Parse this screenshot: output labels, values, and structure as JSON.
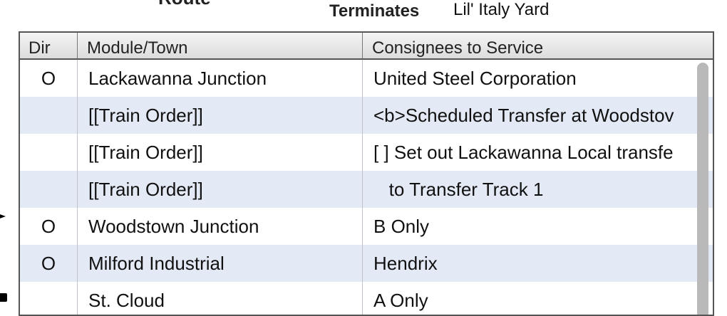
{
  "route_label": "Route",
  "terminates": {
    "label": "Terminates",
    "value": "Lil' Italy Yard"
  },
  "table": {
    "columns": [
      "Dir",
      "Module/Town",
      "Consignees to Service"
    ],
    "rows": [
      {
        "dir": "O",
        "module": "Lackawanna Junction",
        "consignee": "United Steel Corporation"
      },
      {
        "dir": "",
        "module": "[[Train Order]]",
        "consignee": "<b>Scheduled Transfer at Woodstov"
      },
      {
        "dir": "",
        "module": "[[Train Order]]",
        "consignee": "[ ] Set out Lackawanna Local transfe"
      },
      {
        "dir": "",
        "module": "[[Train Order]]",
        "consignee": "   to Transfer Track 1"
      },
      {
        "dir": "O",
        "module": "Woodstown Junction",
        "consignee": "B Only"
      },
      {
        "dir": "O",
        "module": "Milford Industrial",
        "consignee": "Hendrix"
      },
      {
        "dir": "",
        "module": "St. Cloud",
        "consignee": "A Only"
      }
    ]
  }
}
